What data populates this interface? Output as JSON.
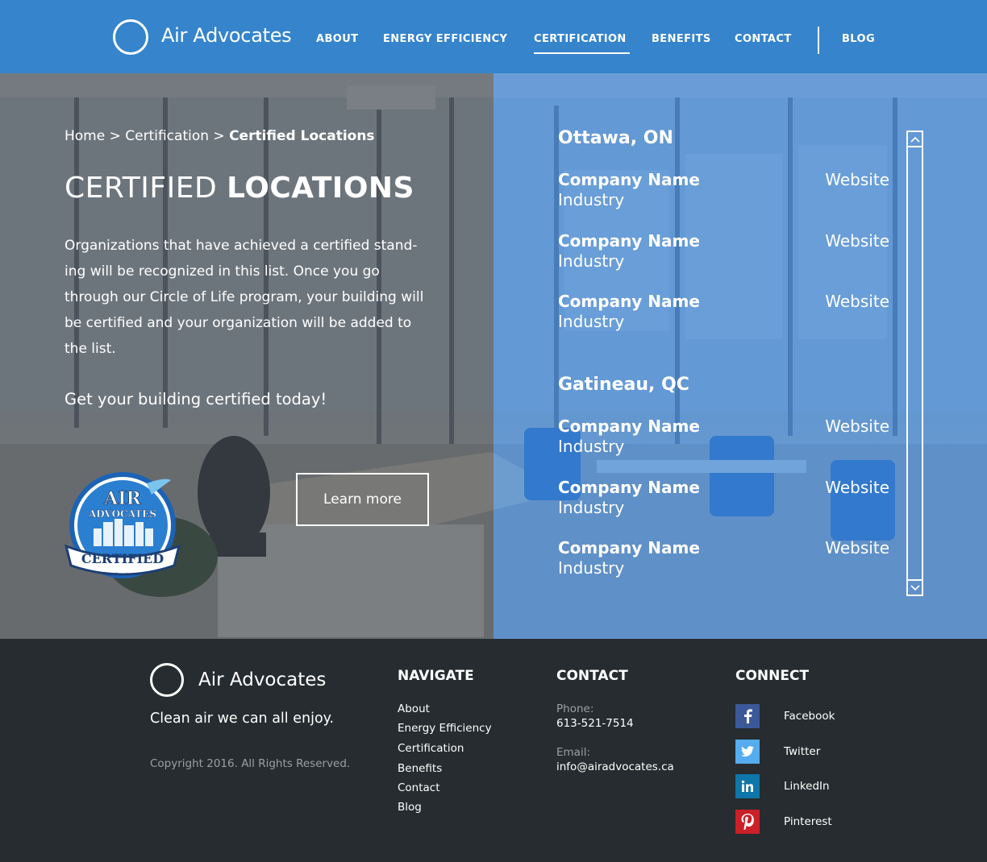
{
  "brand": {
    "name": "Air Advocates"
  },
  "nav": {
    "items": [
      {
        "label": "ABOUT"
      },
      {
        "label": "ENERGY EFFICIENCY"
      },
      {
        "label": "CERTIFICATION",
        "active": true
      },
      {
        "label": "BENEFITS"
      },
      {
        "label": "CONTACT"
      },
      {
        "label": "BLOG"
      }
    ]
  },
  "hero": {
    "breadcrumb": {
      "home": "Home",
      "sep1": " > ",
      "section": "Certification",
      "sep2": " > ",
      "current": "Certified Locations"
    },
    "title_light": "CERTIFIED ",
    "title_bold": "LOCATIONS",
    "description": "Organizations that have achieved a certified stand-ing will be recognized in this list. Once you go through our Circle of Life program, your building will be certified and your organization will be added to the list.",
    "cta_text": "Get your building certified today!",
    "learn_more": "Learn more",
    "badge": {
      "line1": "AIR",
      "line2": "ADVOCATES",
      "ribbon": "CERTIFIED",
      "url": "airadvocates.ca"
    }
  },
  "locations": [
    {
      "city": "Ottawa, ON",
      "companies": [
        {
          "name": "Company Name",
          "industry": "Industry",
          "website": "Website"
        },
        {
          "name": "Company Name",
          "industry": "Industry",
          "website": "Website"
        },
        {
          "name": "Company Name",
          "industry": "Industry",
          "website": "Website"
        }
      ]
    },
    {
      "city": "Gatineau, QC",
      "companies": [
        {
          "name": "Company Name",
          "industry": "Industry",
          "website": "Website"
        },
        {
          "name": "Company Name",
          "industry": "Industry",
          "website": "Website"
        },
        {
          "name": "Company Name",
          "industry": "Industry",
          "website": "Website"
        }
      ]
    }
  ],
  "footer": {
    "brand": "Air Advocates",
    "tagline": "Clean air we can all enjoy.",
    "copyright": "Copyright 2016. All Rights Reserved.",
    "navigate": {
      "heading": "NAVIGATE",
      "links": [
        "About",
        "Energy Efficiency",
        "Certification",
        "Benefits",
        "Contact",
        "Blog"
      ]
    },
    "contact": {
      "heading": "CONTACT",
      "phone_label": "Phone:",
      "phone": "613-521-7514",
      "email_label": "Email:",
      "email": "info@airadvocates.ca"
    },
    "connect": {
      "heading": "CONNECT",
      "links": [
        {
          "label": "Facebook",
          "icon": "facebook-icon",
          "color": "#3b5998"
        },
        {
          "label": "Twitter",
          "icon": "twitter-icon",
          "color": "#55acee"
        },
        {
          "label": "LinkedIn",
          "icon": "linkedin-icon",
          "color": "#0e76a8"
        },
        {
          "label": "Pinterest",
          "icon": "pinterest-icon",
          "color": "#cb2027"
        }
      ]
    }
  },
  "colors": {
    "header_blue": "#3584cc",
    "footer_dark": "#262c2f",
    "overlay_blue": "#357fd3"
  }
}
